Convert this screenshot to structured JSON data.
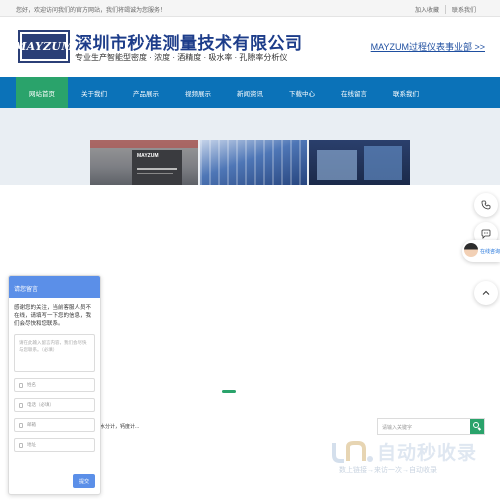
{
  "topbar": {
    "welcome": "您好，欢迎访问我们的官方网站，我们将竭诚为您服务！",
    "links": [
      "加入收藏",
      "联系我们"
    ]
  },
  "header": {
    "logo_text": "MAYZUM",
    "company_name": "深圳市秒准测量技术有限公司",
    "tagline": "专业生产智能型密度 · 浓度 · 酒精度 · 吸水率 · 孔隙率分析仪",
    "link": "MAYZUM过程仪表事业部 >>"
  },
  "nav": {
    "items": [
      "网站首页",
      "关于我们",
      "产品展示",
      "视频展示",
      "新闻资讯",
      "下载中心",
      "在线留言",
      "联系我们"
    ],
    "active_index": 0,
    "active_color": "#2aa36b",
    "bar_color": "#0b72b8"
  },
  "banner": {
    "sign_brand": "MAYZUM",
    "slide_index": 0,
    "slide_count": 1
  },
  "footer": {
    "text": "水分计，钙度计..."
  },
  "chat": {
    "title": "请您留言",
    "intro": "感谢您的关注，当前客服人员不在线，请填写一下您的信息，我们会尽快和您联系。",
    "message_placeholder": "请在此输入留言内容，我们会尽快与您联系。（必填）",
    "fields": [
      "姓名",
      "电话（必填）",
      "邮箱",
      "地址"
    ],
    "submit": "提交",
    "accent": "#5b8fe8"
  },
  "right_tools": {
    "phone_icon": "phone-icon",
    "chat_icon": "chat-bubble-icon",
    "agent_label": "在线咨询",
    "top_icon": "chevron-up-icon"
  },
  "search": {
    "placeholder": "请输入关键字"
  },
  "watermark": {
    "title": "自动秒收录",
    "subtitle": "数上链接→来访一次→自动收录"
  }
}
